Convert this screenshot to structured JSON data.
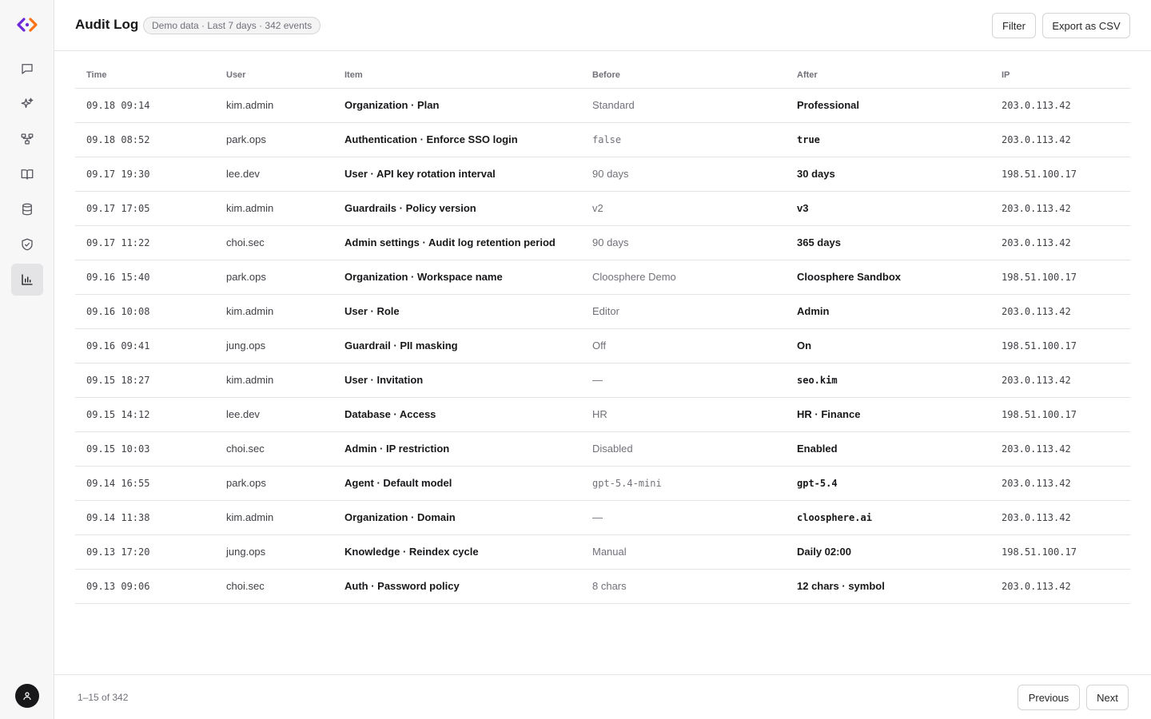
{
  "sidebar": {
    "items": [
      {
        "icon": "chat-icon"
      },
      {
        "icon": "sparkles-icon"
      },
      {
        "icon": "workflow-icon"
      },
      {
        "icon": "book-icon"
      },
      {
        "icon": "database-icon"
      },
      {
        "icon": "shield-check-icon"
      },
      {
        "icon": "bar-chart-icon",
        "active": true
      }
    ],
    "accent_color": "#6d28d9"
  },
  "header": {
    "title": "Audit Log",
    "badge": "Demo data · Last 7 days · 342 events",
    "filter_label": "Filter",
    "export_label": "Export as CSV"
  },
  "table": {
    "columns": [
      "Time",
      "User",
      "Item",
      "Before",
      "After",
      "IP"
    ],
    "rows": [
      {
        "time": "09.18 09:14",
        "user": "kim.admin",
        "item": "Organization · Plan",
        "before": "Standard",
        "after": "Professional",
        "ip": "203.0.113.42"
      },
      {
        "time": "09.18 08:52",
        "user": "park.ops",
        "item": "Authentication · Enforce SSO login",
        "before": "false",
        "after": "true",
        "ip": "203.0.113.42",
        "mono": true
      },
      {
        "time": "09.17 19:30",
        "user": "lee.dev",
        "item": "User · API key rotation interval",
        "before": "90 days",
        "after": "30 days",
        "ip": "198.51.100.17"
      },
      {
        "time": "09.17 17:05",
        "user": "kim.admin",
        "item": "Guardrails · Policy version",
        "before": "v2",
        "after": "v3",
        "ip": "203.0.113.42"
      },
      {
        "time": "09.17 11:22",
        "user": "choi.sec",
        "item": "Admin settings · Audit log retention period",
        "before": "90 days",
        "after": "365 days",
        "ip": "203.0.113.42"
      },
      {
        "time": "09.16 15:40",
        "user": "park.ops",
        "item": "Organization · Workspace name",
        "before": "Cloosphere Demo",
        "after": "Cloosphere Sandbox",
        "ip": "198.51.100.17"
      },
      {
        "time": "09.16 10:08",
        "user": "kim.admin",
        "item": "User · Role",
        "before": "Editor",
        "after": "Admin",
        "ip": "203.0.113.42"
      },
      {
        "time": "09.16 09:41",
        "user": "jung.ops",
        "item": "Guardrail · PII masking",
        "before": "Off",
        "after": "On",
        "ip": "198.51.100.17"
      },
      {
        "time": "09.15 18:27",
        "user": "kim.admin",
        "item": "User · Invitation",
        "before": "—",
        "after": "seo.kim",
        "ip": "203.0.113.42",
        "after_mono": true
      },
      {
        "time": "09.15 14:12",
        "user": "lee.dev",
        "item": "Database · Access",
        "before": "HR",
        "after": "HR · Finance",
        "ip": "198.51.100.17"
      },
      {
        "time": "09.15 10:03",
        "user": "choi.sec",
        "item": "Admin · IP restriction",
        "before": "Disabled",
        "after": "Enabled",
        "ip": "203.0.113.42"
      },
      {
        "time": "09.14 16:55",
        "user": "park.ops",
        "item": "Agent · Default model",
        "before": "gpt-5.4-mini",
        "after": "gpt-5.4",
        "ip": "203.0.113.42",
        "mono": true
      },
      {
        "time": "09.14 11:38",
        "user": "kim.admin",
        "item": "Organization · Domain",
        "before": "—",
        "after": "cloosphere.ai",
        "ip": "203.0.113.42",
        "after_mono": true
      },
      {
        "time": "09.13 17:20",
        "user": "jung.ops",
        "item": "Knowledge · Reindex cycle",
        "before": "Manual",
        "after": "Daily 02:00",
        "ip": "198.51.100.17"
      },
      {
        "time": "09.13 09:06",
        "user": "choi.sec",
        "item": "Auth · Password policy",
        "before": "8 chars",
        "after": "12 chars · symbol",
        "ip": "203.0.113.42"
      }
    ]
  },
  "footer": {
    "page_info": "1–15 of 342",
    "previous_label": "Previous",
    "next_label": "Next"
  }
}
